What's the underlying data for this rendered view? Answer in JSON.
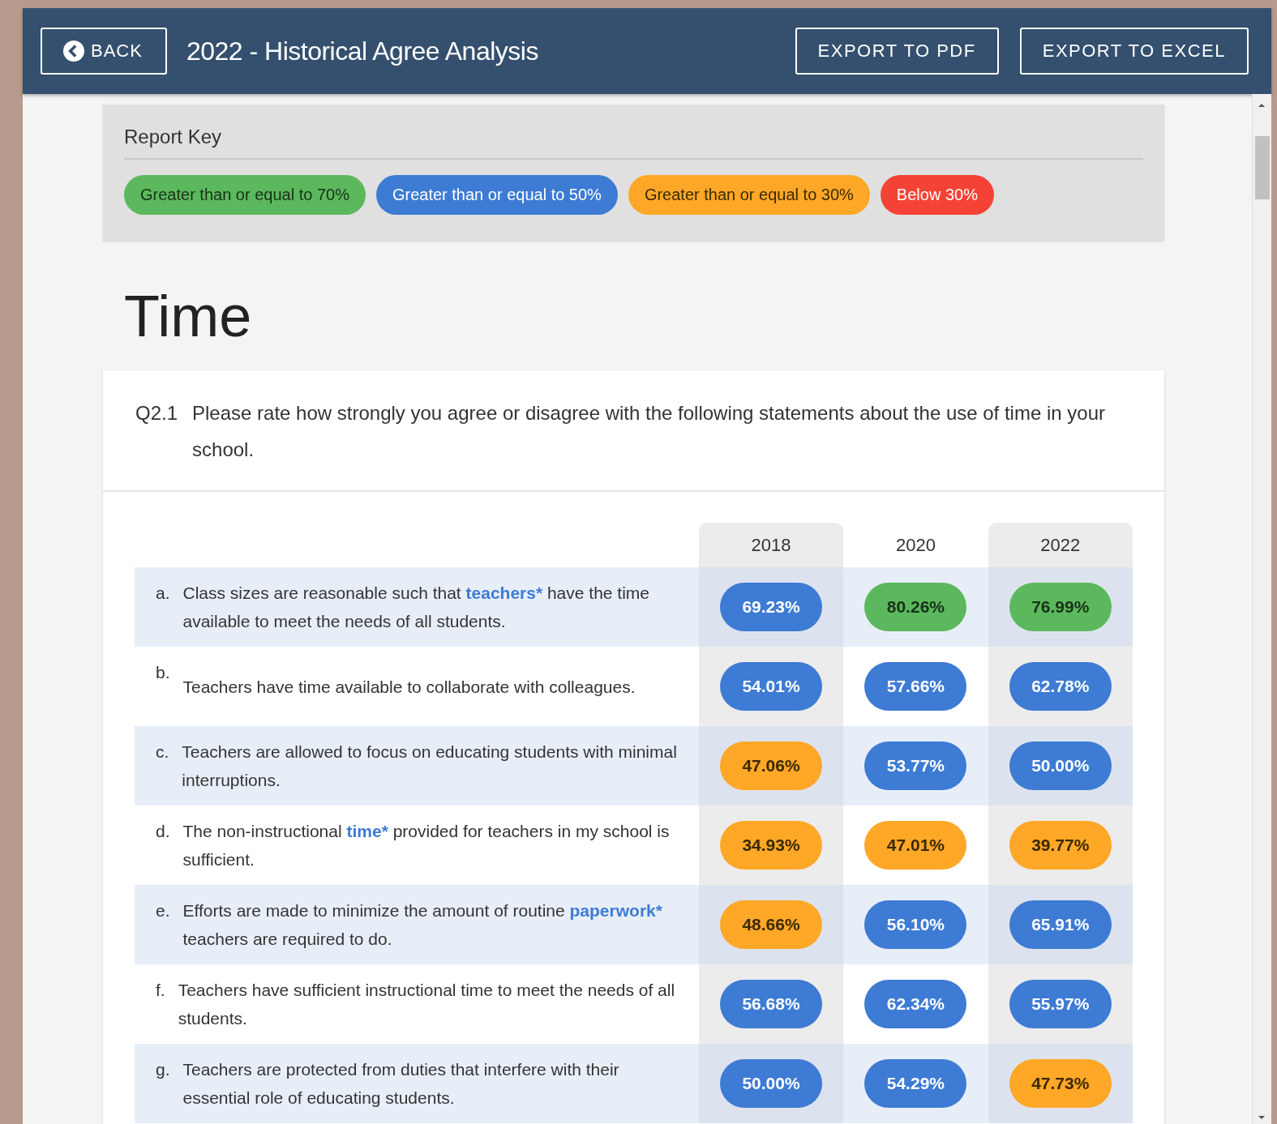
{
  "header": {
    "back": "BACK",
    "title": "2022 - Historical Agree Analysis",
    "buttons": [
      "EXPORT TO PDF",
      "EXPORT TO EXCEL"
    ]
  },
  "report_key": {
    "title": "Report Key",
    "items": [
      {
        "label": "Greater than or equal to 70%",
        "color": "#5cb85c"
      },
      {
        "label": "Greater than or equal to 50%",
        "color": "#3d7bd4"
      },
      {
        "label": "Greater than or equal to 30%",
        "color": "#ffa726"
      },
      {
        "label": "Below 30%",
        "color": "#f44336"
      }
    ]
  },
  "section_title": "Time",
  "question": {
    "number": "Q2.1",
    "text": "Please rate how strongly you agree or disagree with the following statements about the use of time in your school."
  },
  "table": {
    "columns": [
      "2018",
      "2020",
      "2022"
    ],
    "rows": [
      {
        "letter": "a.",
        "parts": [
          {
            "text": "Class sizes are reasonable such that "
          },
          {
            "text": "teachers*",
            "kind": "term"
          },
          {
            "text": " have the time available to meet the needs of all students."
          }
        ],
        "values": [
          {
            "text": "69.23%",
            "color": "#3d7bd4"
          },
          {
            "text": "80.26%",
            "color": "#5cb85c"
          },
          {
            "text": "76.99%",
            "color": "#5cb85c"
          }
        ]
      },
      {
        "letter": "b.",
        "parts": [
          {
            "text": "Teachers have time available to collaborate with colleagues."
          }
        ],
        "values": [
          {
            "text": "54.01%",
            "color": "#3d7bd4"
          },
          {
            "text": "57.66%",
            "color": "#3d7bd4"
          },
          {
            "text": "62.78%",
            "color": "#3d7bd4"
          }
        ]
      },
      {
        "letter": "c.",
        "parts": [
          {
            "text": "Teachers are allowed to focus on educating students with minimal interruptions."
          }
        ],
        "values": [
          {
            "text": "47.06%",
            "color": "#ffa726"
          },
          {
            "text": "53.77%",
            "color": "#3d7bd4"
          },
          {
            "text": "50.00%",
            "color": "#3d7bd4"
          }
        ]
      },
      {
        "letter": "d.",
        "parts": [
          {
            "text": "The non-instructional "
          },
          {
            "text": "time*",
            "kind": "term"
          },
          {
            "text": " provided for teachers in my school is sufficient."
          }
        ],
        "values": [
          {
            "text": "34.93%",
            "color": "#ffa726"
          },
          {
            "text": "47.01%",
            "color": "#ffa726"
          },
          {
            "text": "39.77%",
            "color": "#ffa726"
          }
        ]
      },
      {
        "letter": "e.",
        "parts": [
          {
            "text": "Efforts are made to minimize the amount of routine "
          },
          {
            "text": "paperwork*",
            "kind": "term"
          },
          {
            "text": " teachers are required to do."
          }
        ],
        "values": [
          {
            "text": "48.66%",
            "color": "#ffa726"
          },
          {
            "text": "56.10%",
            "color": "#3d7bd4"
          },
          {
            "text": "65.91%",
            "color": "#3d7bd4"
          }
        ]
      },
      {
        "letter": "f.",
        "parts": [
          {
            "text": "Teachers have sufficient instructional time to meet the needs of all students."
          }
        ],
        "values": [
          {
            "text": "56.68%",
            "color": "#3d7bd4"
          },
          {
            "text": "62.34%",
            "color": "#3d7bd4"
          },
          {
            "text": "55.97%",
            "color": "#3d7bd4"
          }
        ]
      },
      {
        "letter": "g.",
        "parts": [
          {
            "text": "Teachers are protected from duties that interfere with their essential role of educating students."
          }
        ],
        "values": [
          {
            "text": "50.00%",
            "color": "#3d7bd4"
          },
          {
            "text": "54.29%",
            "color": "#3d7bd4"
          },
          {
            "text": "47.73%",
            "color": "#ffa726"
          }
        ]
      }
    ]
  }
}
